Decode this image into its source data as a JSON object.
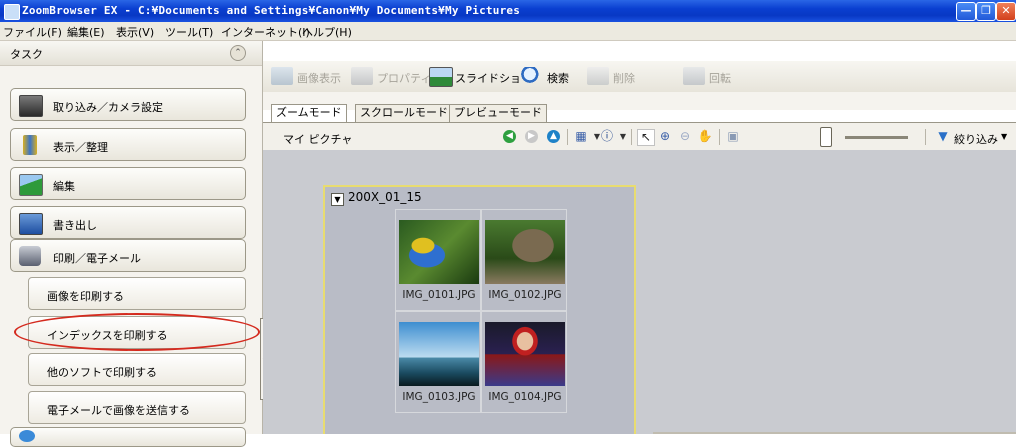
{
  "window": {
    "title": "ZoomBrowser EX - C:¥Documents and Settings¥Canon¥My Documents¥My Pictures",
    "buttons": [
      "minimize-icon",
      "restore-icon",
      "close-icon"
    ]
  },
  "menu": [
    "ファイル(F)",
    "編集(E)",
    "表示(V)",
    "ツール(T)",
    "インターネット(I)",
    "ヘルプ(H)"
  ],
  "task_panel": {
    "header": "タスク",
    "items": [
      {
        "label": "取り込み／カメラ設定",
        "icon": "camera-icon"
      },
      {
        "label": "表示／整理",
        "icon": "books-icon"
      },
      {
        "label": "編集",
        "icon": "edit-picture-icon"
      },
      {
        "label": "書き出し",
        "icon": "export-icon"
      },
      {
        "label": "印刷／電子メール",
        "icon": "printer-icon"
      }
    ],
    "subitems": [
      "画像を印刷する",
      "インデックスを印刷する",
      "他のソフトで印刷する",
      "電子メールで画像を送信する"
    ],
    "highlighted": "インデックスを印刷する"
  },
  "toolbar": [
    {
      "label": "画像表示",
      "icon": "view-image-icon",
      "enabled": false
    },
    {
      "label": "プロパティ",
      "icon": "properties-icon",
      "enabled": false
    },
    {
      "label": "スライドショー",
      "icon": "slideshow-icon",
      "enabled": true
    },
    {
      "label": "検索",
      "icon": "search-icon",
      "enabled": true
    },
    {
      "label": "削除",
      "icon": "trash-icon",
      "enabled": false
    },
    {
      "label": "回転",
      "icon": "rotate-icon",
      "enabled": false
    }
  ],
  "tabs": [
    {
      "label": "ズームモード",
      "active": true
    },
    {
      "label": "スクロールモード",
      "active": false
    },
    {
      "label": "プレビューモード",
      "active": false
    }
  ],
  "view": {
    "title": "マイ ピクチャ",
    "filter_label": "絞り込み",
    "zoom_level": 0
  },
  "folder": {
    "name": "200X_01_15",
    "images": [
      {
        "name": "IMG_0101.JPG",
        "subject": "parrot"
      },
      {
        "name": "IMG_0102.JPG",
        "subject": "tortoise"
      },
      {
        "name": "IMG_0103.JPG",
        "subject": "palm-beach"
      },
      {
        "name": "IMG_0104.JPG",
        "subject": "child"
      }
    ]
  },
  "colors": {
    "accent": "#0a3fd0",
    "highlight": "#d42a1e",
    "folder_border": "#e8dc70"
  }
}
